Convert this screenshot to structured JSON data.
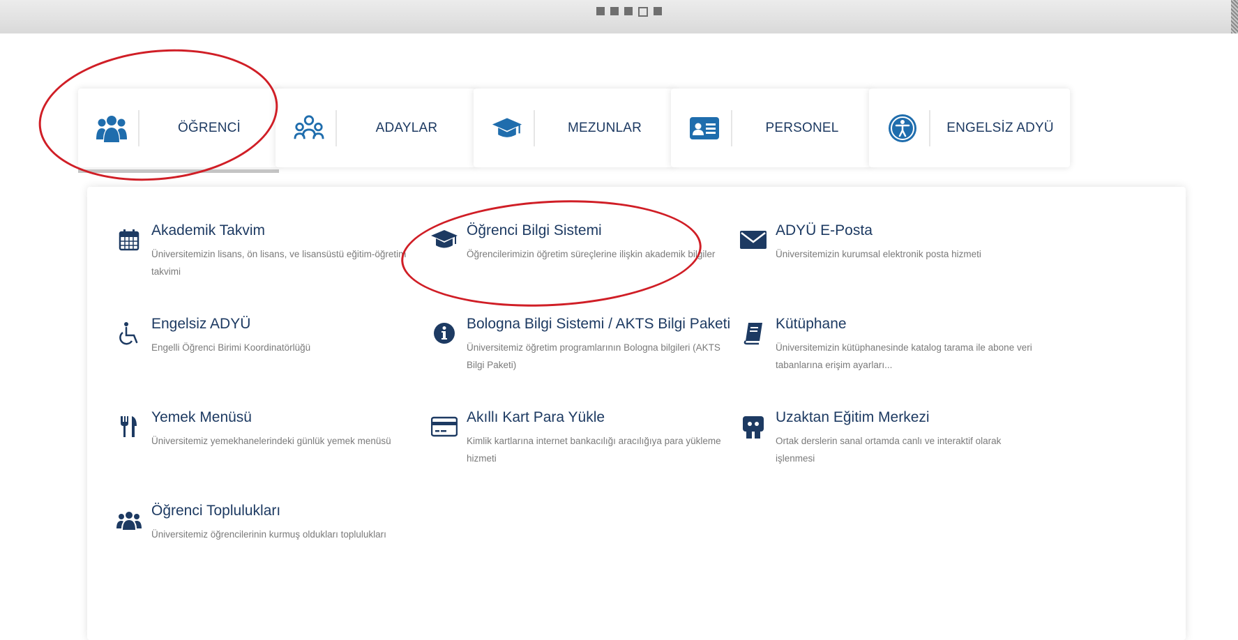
{
  "colors": {
    "navy": "#1d3a62",
    "icon_blue": "#1f6dad",
    "desc_gray": "#7a7a7a",
    "annotation_red": "#d01e26"
  },
  "slider": {
    "dots": [
      "filled",
      "filled",
      "filled",
      "empty",
      "filled"
    ]
  },
  "tabs": [
    {
      "label": "ÖĞRENCİ",
      "icon": "students-group-icon",
      "active": true
    },
    {
      "label": "ADAYLAR",
      "icon": "candidates-group-icon",
      "active": false
    },
    {
      "label": "MEZUNLAR",
      "icon": "graduation-cap-icon",
      "active": false
    },
    {
      "label": "PERSONEL",
      "icon": "id-card-icon",
      "active": false
    },
    {
      "label": "ENGELSİZ ADYÜ",
      "icon": "accessibility-icon",
      "active": false
    }
  ],
  "services": [
    {
      "title": "Akademik Takvim",
      "desc": "Üniversitemizin lisans, ön lisans, ve lisansüstü eğitim-öğretim takvimi",
      "icon": "calendar-icon"
    },
    {
      "title": "Öğrenci Bilgi Sistemi",
      "desc": "Öğrencilerimizin öğretim süreçlerine ilişkin akademik bilgiler",
      "icon": "graduation-cap-icon"
    },
    {
      "title": "ADYÜ E-Posta",
      "desc": "Üniversitemizin kurumsal elektronik posta hizmeti",
      "icon": "envelope-icon"
    },
    {
      "title": "Engelsiz ADYÜ",
      "desc": "Engelli Öğrenci Birimi Koordinatörlüğü",
      "icon": "wheelchair-icon"
    },
    {
      "title": "Bologna Bilgi Sistemi / AKTS Bilgi Paketi",
      "desc": "Üniversitemiz öğretim programlarının Bologna bilgileri (AKTS Bilgi Paketi)",
      "icon": "info-circle-icon"
    },
    {
      "title": "Kütüphane",
      "desc": "Üniversitemizin kütüphanesinde katalog tarama ile abone veri tabanlarına erişim ayarları...",
      "icon": "book-icon"
    },
    {
      "title": "Yemek Menüsü",
      "desc": "Üniversitemiz yemekhanelerindeki günlük yemek menüsü",
      "icon": "fork-knife-icon"
    },
    {
      "title": "Akıllı Kart Para Yükle",
      "desc": "Kimlik kartlarına internet bankacılığı aracılığıya para yükleme hizmeti",
      "icon": "credit-card-icon"
    },
    {
      "title": "Uzaktan Eğitim Merkezi",
      "desc": "Ortak derslerin sanal ortamda canlı ve interaktif olarak işlenmesi",
      "icon": "presentation-icon"
    },
    {
      "title": "Öğrenci Toplulukları",
      "desc": "Üniversitemiz öğrencilerinin kurmuş oldukları toplulukları",
      "icon": "users-icon"
    }
  ]
}
